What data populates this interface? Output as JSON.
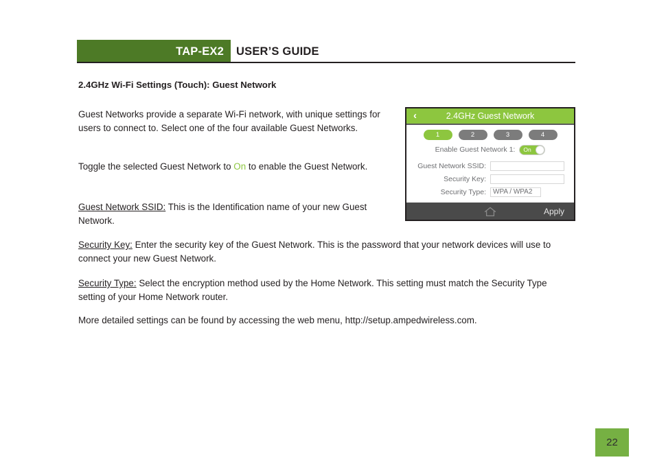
{
  "header": {
    "product": "TAP-EX2",
    "guide": "USER’S GUIDE"
  },
  "section_heading": "2.4GHz Wi-Fi Settings (Touch): Guest Network",
  "paragraphs": {
    "p1": "Guest Networks provide a separate Wi-Fi network, with unique settings for users to connect to.  Select one of the four available Guest Networks.",
    "p2_before": "Toggle the selected Guest Network to ",
    "p2_accent": "On",
    "p2_after": " to enable the Guest Network.",
    "p3_label": "Guest Network SSID:",
    "p3_text": " This is the Identification name of your new Guest Network.",
    "p4_label": "Security Key:",
    "p4_text": " Enter the security key of the Guest Network. This is the password that your network devices will use to connect your new Guest Network.",
    "p5_label": "Security Type:",
    "p5_text": " Select the encryption method used by the Home Network. This setting must match the Security Type setting of your Home Network router.",
    "p6": "More detailed settings can be found by accessing the web menu, http://setup.ampedwireless.com."
  },
  "device": {
    "back_glyph": "‹",
    "title": "2.4GHz Guest Network",
    "tabs": [
      {
        "label": "1",
        "active": true
      },
      {
        "label": "2",
        "active": false
      },
      {
        "label": "3",
        "active": false
      },
      {
        "label": "4",
        "active": false
      }
    ],
    "toggle": {
      "label": "Enable Guest Network 1:",
      "state_text": "On",
      "enabled": true
    },
    "fields": [
      {
        "label": "Guest Network SSID:",
        "value": "",
        "narrow": false
      },
      {
        "label": "Security Key:",
        "value": "",
        "narrow": false
      },
      {
        "label": "Security Type:",
        "value": "WPA / WPA2",
        "narrow": true
      }
    ],
    "footer": {
      "home_icon": "home-icon",
      "apply_label": "Apply"
    }
  },
  "page_number": "22",
  "colors": {
    "header_green": "#4d7a26",
    "accent_green": "#8dc63f",
    "page_badge_green": "#76b043",
    "footer_gray": "#4a4a4a",
    "tab_inactive_gray": "#7c7c7c"
  }
}
